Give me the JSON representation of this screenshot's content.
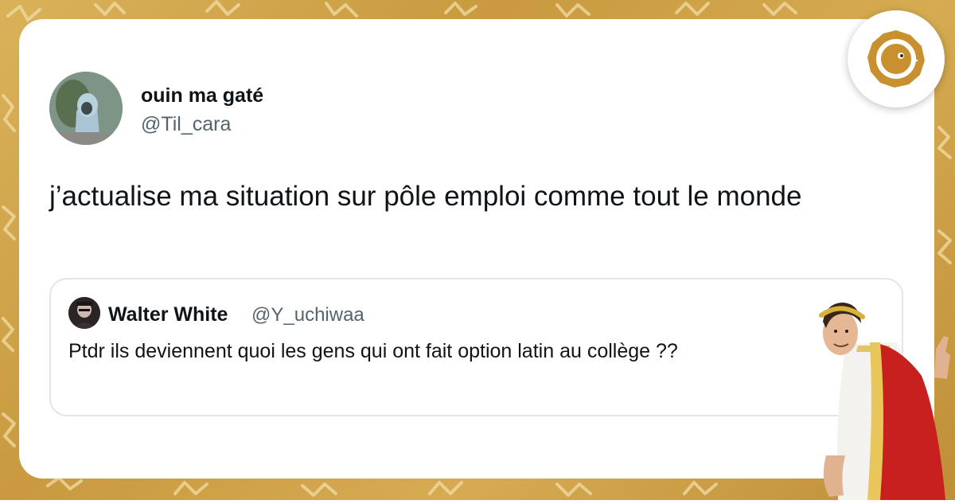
{
  "tweet": {
    "display_name": "ouin ma gaté",
    "handle": "@Til_cara",
    "text": "j’actualise ma situation sur pôle emploi comme tout le monde"
  },
  "quoted_tweet": {
    "display_name": "Walter White",
    "handle": "@Y_uchiwaa",
    "text": "Ptdr ils deviennent quoi les gens qui ont fait option latin au collège ??"
  },
  "icons": {
    "brand": "golden-bird-logo-icon",
    "mascot": "roman-emperor-thumbs-up-icon"
  },
  "colors": {
    "background": "#d2a54d",
    "card": "#ffffff",
    "text_primary": "#0f1419",
    "text_secondary": "#536471",
    "brand_gold": "#c8902e"
  }
}
